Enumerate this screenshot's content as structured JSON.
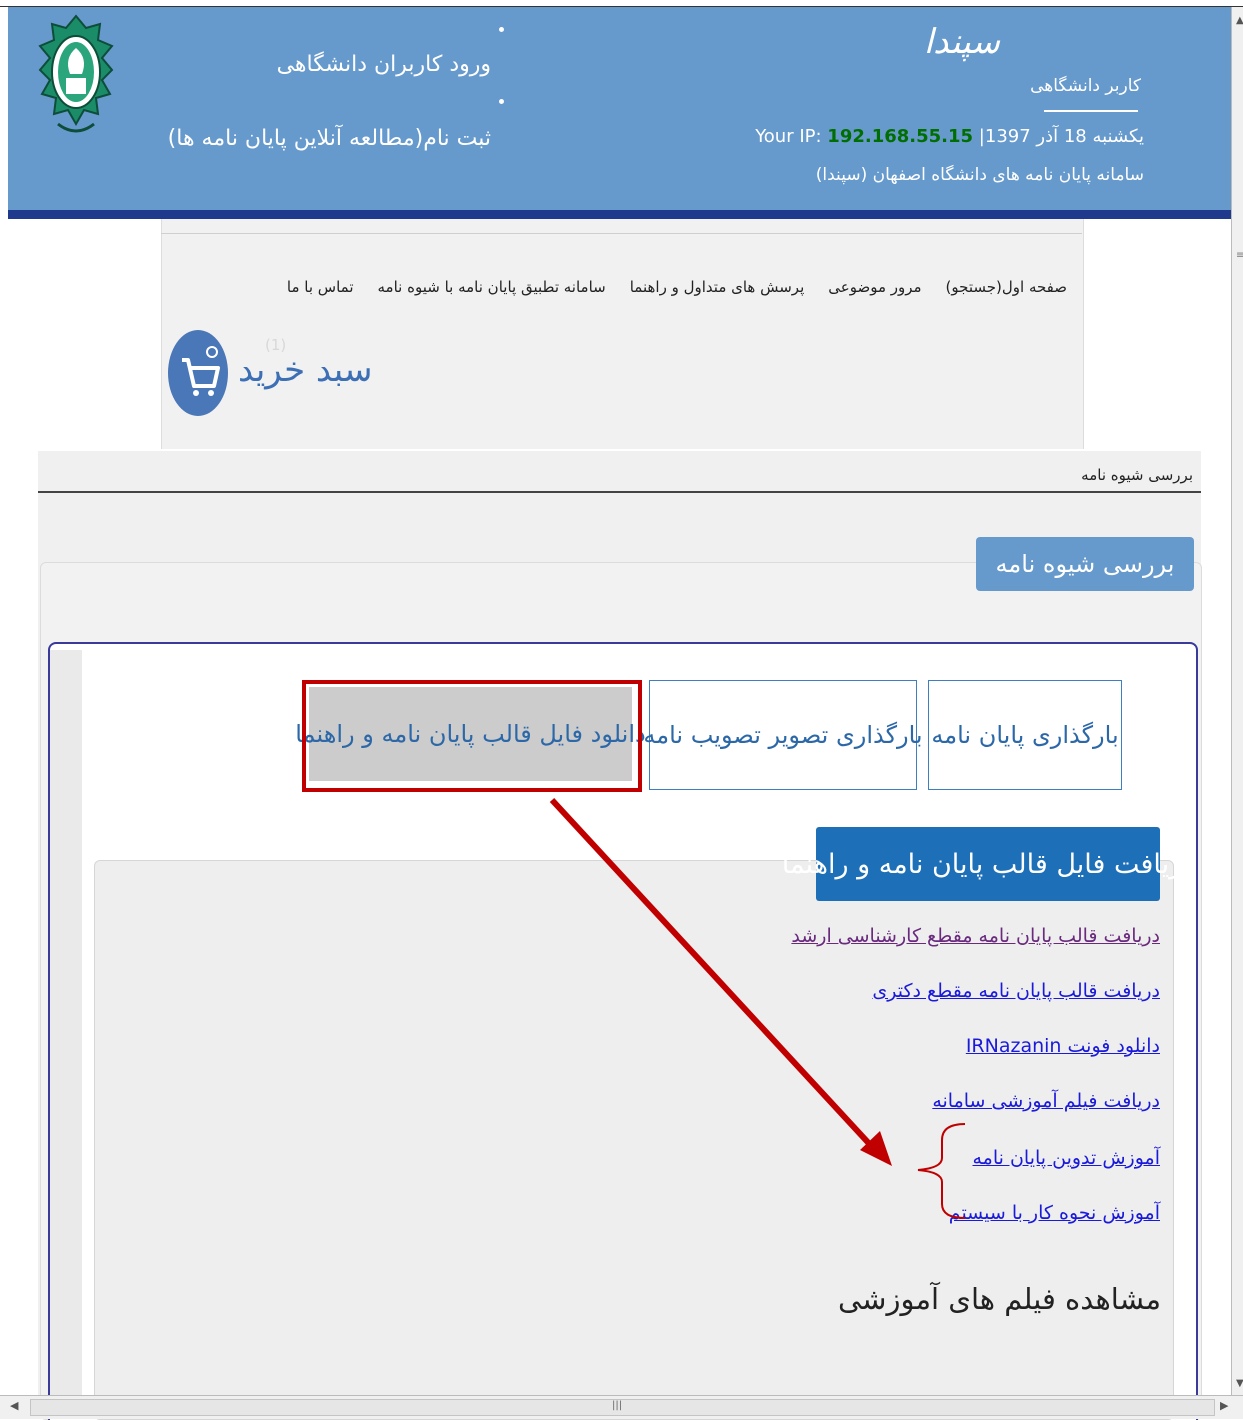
{
  "header": {
    "login_link": "ورود کاربران دانشگاهی",
    "register_link": "ثبت نام(مطالعه آنلاین پایان نامه ها)",
    "brand": "سپندا",
    "user_label": "کاربر دانشگاهی",
    "date_text": "یکشنبه 18 آذر 1397|",
    "ip_label": "Your IP:",
    "ip_value": "192.168.55.15",
    "system_name": "سامانه پایان نامه های دانشگاه اصفهان (سپندا)",
    "logo": "university-of-isfahan-logo"
  },
  "nav": {
    "items": [
      "صفحه اول(جستجو)",
      "مرور موضوعی",
      "پرسش های متداول و راهنما",
      "سامانه تطبیق پایان نامه با شیوه نامه",
      "تماس با ما"
    ]
  },
  "cart": {
    "label": "سبد خرید",
    "count": "(1)",
    "icon": "shopping-cart-icon"
  },
  "breadcrumb": "بررسی شیوه نامه",
  "page_title": "بررسی شیوه نامه",
  "tabs": {
    "upload_thesis": "بارگذاری پایان نامه",
    "upload_approval": "بارگذاری تصویر تصویب نامه",
    "download_template": "دانلود فایل قالب پایان نامه و راهنما"
  },
  "section": {
    "title": "دریافت فایل قالب پایان نامه و راهنما",
    "links": [
      "دریافت قالب پایان نامه مقطع کارشناسی ارشد",
      "دریافت قالب پایان نامه مقطع دکتری",
      "دانلود فونت IRNazanin",
      "دریافت فیلم آموزشی سامانه",
      "آموزش تدوین پایان نامه",
      "آموزش نحوه کار با سیستم"
    ],
    "videos_heading": "مشاهده فیلم های آموزشی"
  },
  "colors": {
    "header_bg": "#6699cc",
    "header_bar": "#1f3a8c",
    "ip_green": "#006e00",
    "section_title_bg": "#1d6fb8",
    "highlight_red": "#c00000",
    "link_blue": "#1a1adb",
    "visited_link": "#6a2a7e"
  }
}
